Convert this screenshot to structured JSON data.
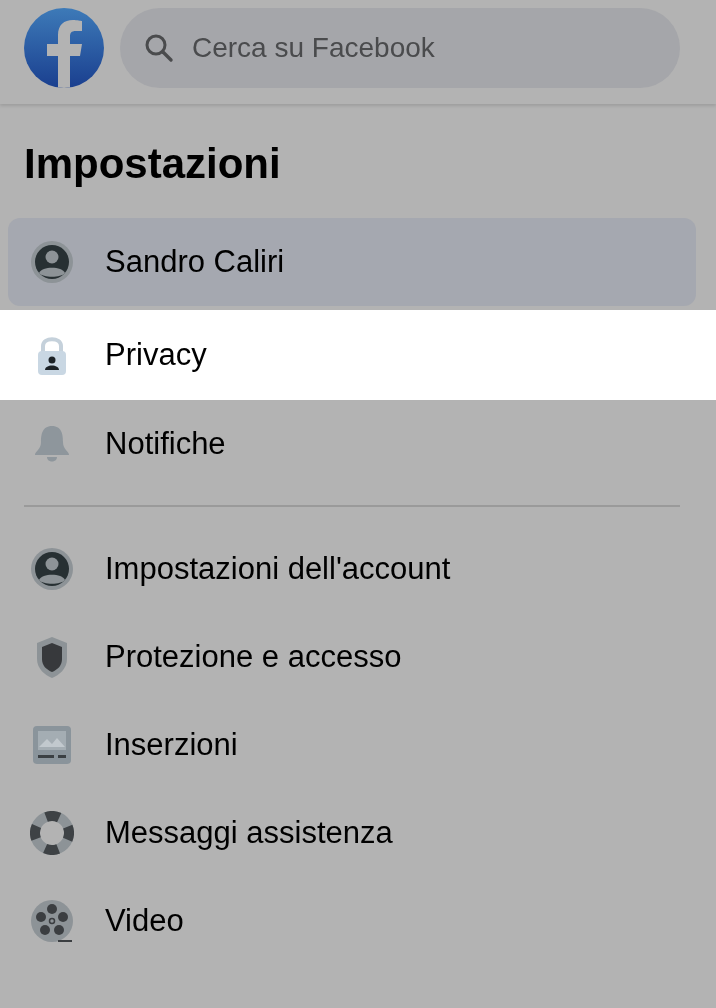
{
  "search": {
    "placeholder": "Cerca su Facebook"
  },
  "title": "Impostazioni",
  "groups": [
    {
      "items": [
        {
          "label": "Sandro Caliri",
          "kind": "person",
          "selected": true,
          "highlighted": false
        },
        {
          "label": "Privacy",
          "kind": "lock",
          "selected": false,
          "highlighted": true
        },
        {
          "label": "Notifiche",
          "kind": "bell",
          "selected": false,
          "highlighted": false
        }
      ]
    },
    {
      "items": [
        {
          "label": "Impostazioni dell'account",
          "kind": "person",
          "selected": false,
          "highlighted": false
        },
        {
          "label": "Protezione e accesso",
          "kind": "shield",
          "selected": false,
          "highlighted": false
        },
        {
          "label": "Inserzioni",
          "kind": "ad",
          "selected": false,
          "highlighted": false
        },
        {
          "label": "Messaggi assistenza",
          "kind": "lifebuoy",
          "selected": false,
          "highlighted": false
        },
        {
          "label": "Video",
          "kind": "film",
          "selected": false,
          "highlighted": false
        }
      ]
    }
  ]
}
